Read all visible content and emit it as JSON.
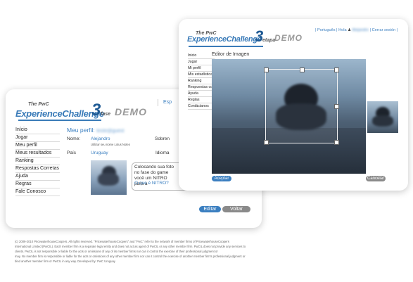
{
  "back_card": {
    "logo": {
      "pre": "The PwC",
      "main": "ExperienceChallenge",
      "number": "3",
      "suffix": "fase",
      "demo": "DEMO"
    },
    "top_link": "Esp",
    "sidebar": [
      "Início",
      "Jogar",
      "Meu perfil",
      "Meus resultados",
      "Ranking",
      "Respostas Corretas",
      "Ajuda",
      "Regras",
      "Fale Conosco"
    ],
    "profile": {
      "title": "Meu perfil:",
      "email": "teste@guest",
      "name_label": "Nome:",
      "name_value": "Alejandro",
      "name_hint": "Utilizar seu nome Lotus Notes",
      "surname_label": "Sobren",
      "country_label": "País",
      "country_value": "Uruguay",
      "language_label": "Idioma",
      "callout_text": "Colocando sua foto no fase do game você um NITRO para a",
      "callout_link": "O que é NITRO?"
    },
    "buttons": {
      "edit": "Editar",
      "back": "Voltar"
    }
  },
  "front_card": {
    "logo": {
      "pre": "The PwC",
      "main": "ExperienceChallenge",
      "number": "3",
      "suffix": "etapa",
      "demo": "DEMO"
    },
    "top_links": {
      "lang": "| Português | Hola",
      "user": "Alejandro",
      "logout": "| Cerrar sesión |"
    },
    "sidebar": [
      "Inicio",
      "Jugar",
      "Mi perfil",
      "Mis estadísticas",
      "Ranking",
      "Respuestas correctas",
      "Ayuda",
      "Reglas",
      "Contáctanos"
    ],
    "editor_title": "Editor de Imagen",
    "buttons": {
      "accept": "Aceptar",
      "cancel": "Cancelar"
    }
  },
  "footer": {
    "lines": [
      "(c) 2009-2010 PricewaterhouseCoopers. All rights reserved. \"PricewaterhouseCoopers\" and \"PwC\" refer to the network of member firms of PricewaterhouseCoopers",
      "International Limited (PwCIL). Each member firm is a separate legal entity and does not act as agent of PwCIL or any other member firm. PwCIL does not provide any services to",
      "clients. PwCIL is not responsible or liable for the acts or omissions of any of its member firms nor can it control the exercise of their professional judgment or",
      "may. No member firm is responsible or liable for the acts or omissions of any other member firm nor can it control the exercise of another member firm's professional judgment or",
      "bind another member firm or PwCIL in any way. Developed by: PwC Uruguay"
    ]
  },
  "colors": {
    "accent": "#3b7fc0",
    "logo_blue": "#3a7bb8",
    "demo_gray": "#9a9a9a"
  }
}
